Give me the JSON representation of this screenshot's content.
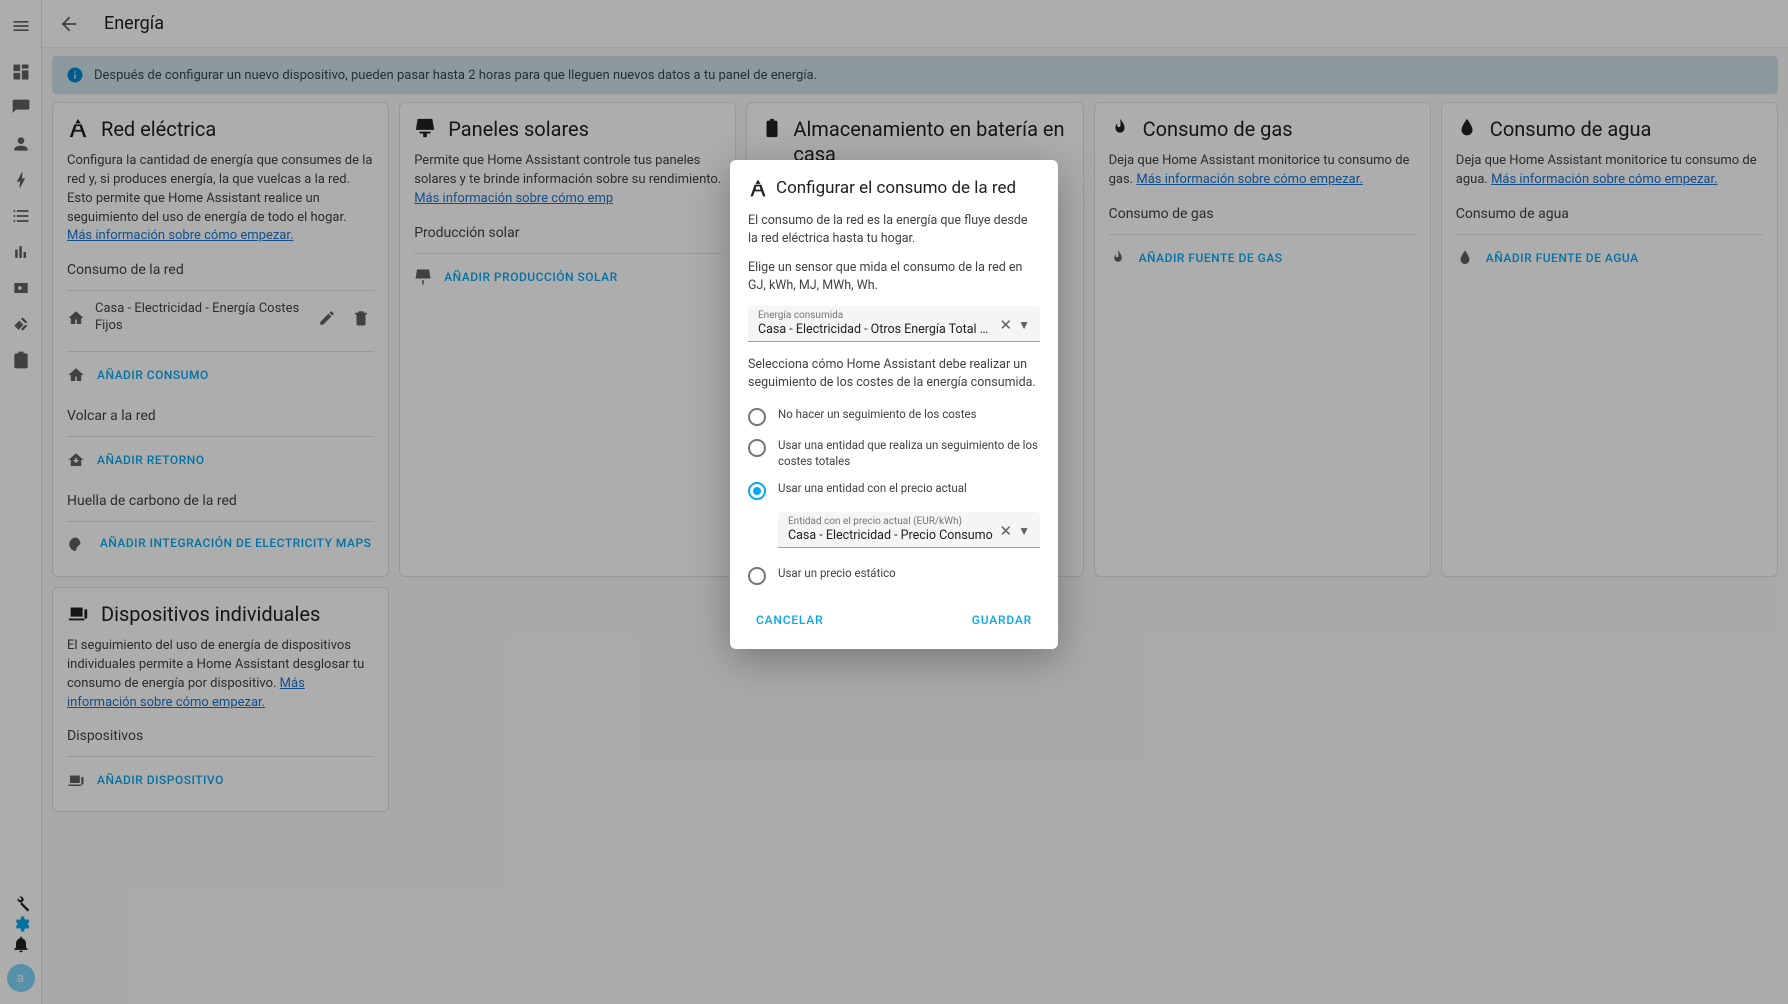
{
  "header": {
    "title": "Energía"
  },
  "info_banner": "Después de configurar un nuevo dispositivo, pueden pasar hasta 2 horas para que lleguen nuevos datos a tu panel de energía.",
  "sidebar": {
    "avatar_letter": "a"
  },
  "cards": {
    "grid": {
      "title": "Red eléctrica",
      "desc": "Configura la cantidad de energía que consumes de la red y, si produces energía, la que vuelcas a la red. Esto permite que Home Assistant realice un seguimiento del uso de energía de todo el hogar.",
      "learn": "Más información sobre cómo empezar.",
      "section_consumo": "Consumo de la red",
      "item1": "Casa - Electricidad - Energía Costes Fijos",
      "add_consumo": "AÑADIR CONSUMO",
      "section_volcar": "Volcar a la red",
      "add_retorno": "AÑADIR RETORNO",
      "section_huella": "Huella de carbono de la red",
      "add_co2": "AÑADIR INTEGRACIÓN DE ELECTRICITY MAPS"
    },
    "solar": {
      "title": "Paneles solares",
      "desc": "Permite que Home Assistant controle tus paneles solares y te brinde información sobre su rendimiento.",
      "learn": "Más información sobre cómo emp",
      "section": "Producción solar",
      "add": "AÑADIR PRODUCCIÓN SOLAR"
    },
    "battery": {
      "title": "Almacenamiento en batería en casa"
    },
    "gas": {
      "title": "Consumo de gas",
      "desc": "Deja que Home Assistant monitorice tu consumo de gas.",
      "learn": "Más información sobre cómo empezar.",
      "section": "Consumo de gas",
      "add": "AÑADIR FUENTE DE GAS"
    },
    "water": {
      "title": "Consumo de agua",
      "desc": "Deja que Home Assistant monitorice tu consumo de agua.",
      "learn": "Más información sobre cómo empezar.",
      "section": "Consumo de agua",
      "add": "AÑADIR FUENTE DE AGUA"
    },
    "devices": {
      "title": "Dispositivos individuales",
      "desc": "El seguimiento del uso de energía de dispositivos individuales permite a Home Assistant desglosar tu consumo de energía por dispositivo.",
      "learn": "Más información sobre cómo empezar.",
      "section": "Dispositivos",
      "add": "AÑADIR DISPOSITIVO"
    }
  },
  "dialog": {
    "title": "Configurar el consumo de la red",
    "p1": "El consumo de la red es la energía que fluye desde la red eléctrica hasta tu hogar.",
    "p2": "Elige un sensor que mida el consumo de la red en GJ, kWh, MJ, MWh, Wh.",
    "select1_label": "Energía consumida",
    "select1_value": "Casa - Electricidad - Otros Energía Total Diaria",
    "cost_intro": "Selecciona cómo Home Assistant debe realizar un seguimiento de los costes de la energía consumida.",
    "opt1": "No hacer un seguimiento de los costes",
    "opt2": "Usar una entidad que realiza un seguimiento de los costes totales",
    "opt3": "Usar una entidad con el precio actual",
    "opt4": "Usar un precio estático",
    "select2_label": "Entidad con el precio actual (EUR/kWh)",
    "select2_value": "Casa - Electricidad - Precio Consumo",
    "cancel": "CANCELAR",
    "save": "GUARDAR"
  }
}
